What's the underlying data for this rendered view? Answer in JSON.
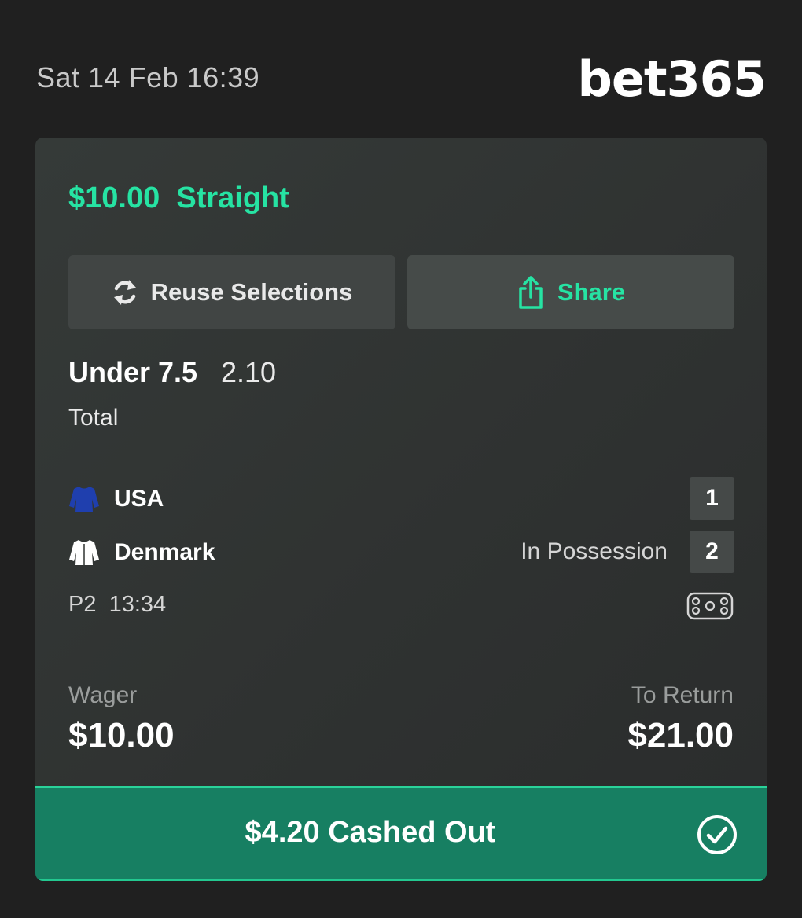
{
  "header": {
    "timestamp": "Sat 14 Feb 16:39",
    "logo_text": "bet365"
  },
  "bet": {
    "stake_amount": "$10.00",
    "bet_type": "Straight",
    "accent_color": "#26e3a3"
  },
  "actions": {
    "reuse_label": "Reuse Selections",
    "reuse_icon": "refresh-icon",
    "share_label": "Share",
    "share_icon": "share-icon"
  },
  "selection": {
    "name": "Under 7.5",
    "odds": "2.10",
    "market": "Total"
  },
  "event": {
    "teams": [
      {
        "name": "USA",
        "score": "1",
        "jersey_icon": "jersey-icon",
        "jersey_color": "#1f3fae"
      },
      {
        "name": "Denmark",
        "score": "2",
        "jersey_icon": "jersey-icon",
        "jersey_color": "#ffffff",
        "status": "In Possession"
      }
    ],
    "period": "P2",
    "clock": "13:34",
    "rink_icon": "hockey-rink-icon"
  },
  "summary": {
    "wager_label": "Wager",
    "wager_value": "$10.00",
    "return_label": "To Return",
    "return_value": "$21.00"
  },
  "cashout": {
    "amount": "$4.20",
    "label": "Cashed Out",
    "icon": "check-circle-icon",
    "bar_color": "#177f62"
  }
}
